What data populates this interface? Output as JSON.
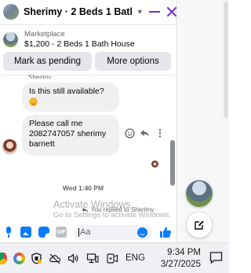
{
  "chat": {
    "title": "Sherimy · 2 Beds 1 Bath Ho...",
    "listing_label": "Marketplace",
    "listing_title": "$1,200 - 2 Beds 1 Bath House",
    "mark_pending_label": "Mark as pending",
    "more_options_label": "More options",
    "sender_name": "Sherimy",
    "messages": [
      {
        "text": "Is this still available?"
      },
      {
        "text": "Please call me 2082747057 sherimy barnett"
      }
    ],
    "timestamp": "Wed 1:40 PM",
    "reply_note": "You replied to Sherimy",
    "input_placeholder": "Aa",
    "gif_label": "GIF"
  },
  "watermark": {
    "title": "Activate Windows",
    "subtitle": "Go to Settings to activate Windows."
  },
  "taskbar": {
    "language": "ENG",
    "time": "9:34 PM",
    "date": "3/27/2025"
  },
  "colors": {
    "messenger_accent": "#7b2cbf",
    "action_blue": "#0a7cff",
    "bubble_gray": "#f0f0f0"
  }
}
